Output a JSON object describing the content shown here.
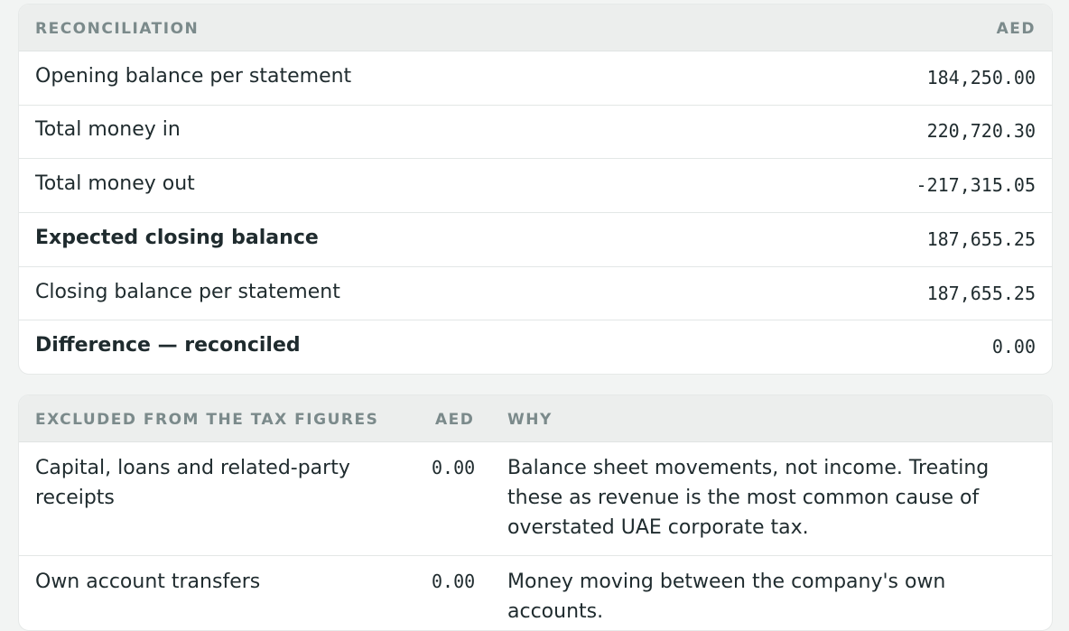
{
  "reconciliation": {
    "header": {
      "title": "RECONCILIATION",
      "currency": "AED"
    },
    "rows": [
      {
        "label": "Opening balance per statement",
        "amount": "184,250.00"
      },
      {
        "label": "Total money in",
        "amount": "220,720.30"
      },
      {
        "label": "Total money out",
        "amount": "-217,315.05"
      },
      {
        "label": "Expected closing balance",
        "amount": "187,655.25"
      },
      {
        "label": "Closing balance per statement",
        "amount": "187,655.25"
      },
      {
        "label": "Difference — reconciled",
        "amount": "0.00"
      }
    ]
  },
  "excluded": {
    "header": {
      "title": "EXCLUDED FROM THE TAX FIGURES",
      "currency": "AED",
      "why": "WHY"
    },
    "rows": [
      {
        "label": "Capital, loans and related-party receipts",
        "amount": "0.00",
        "why": "Balance sheet movements, not income. Treating these as revenue is the most common cause of overstated UAE corporate tax."
      },
      {
        "label": "Own account transfers",
        "amount": "0.00",
        "why": "Money moving between the company's own accounts."
      }
    ]
  }
}
